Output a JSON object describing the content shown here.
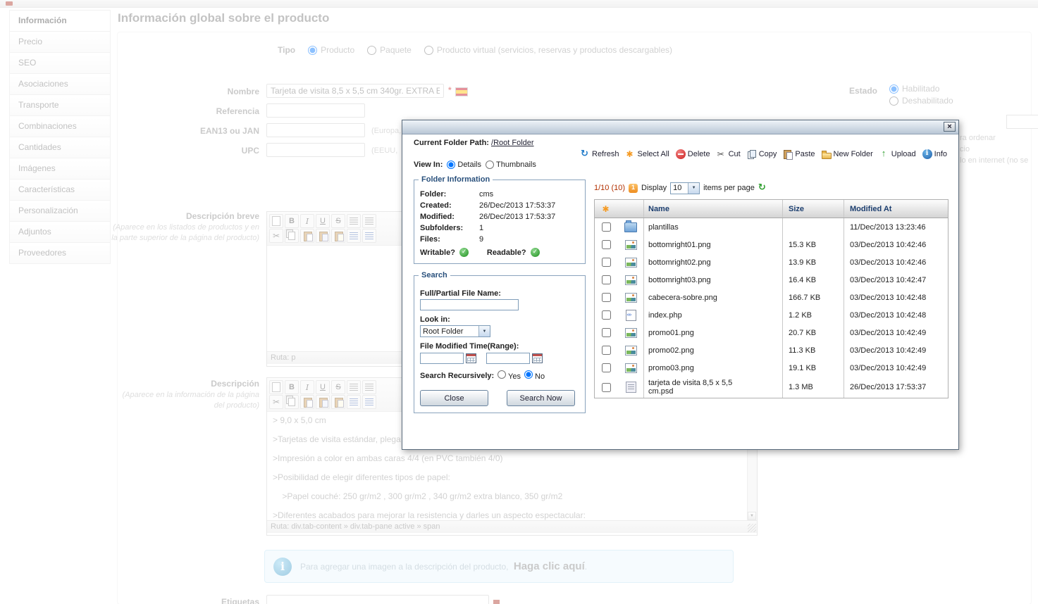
{
  "page": {
    "title": "Información global sobre el producto"
  },
  "sidebar": {
    "items": [
      {
        "label": "Información",
        "active": true
      },
      {
        "label": "Precio",
        "active": false
      },
      {
        "label": "SEO",
        "active": false
      },
      {
        "label": "Asociaciones",
        "active": false
      },
      {
        "label": "Transporte",
        "active": false
      },
      {
        "label": "Combinaciones",
        "active": false
      },
      {
        "label": "Cantidades",
        "active": false
      },
      {
        "label": "Imágenes",
        "active": false
      },
      {
        "label": "Características",
        "active": false
      },
      {
        "label": "Personalización",
        "active": false
      },
      {
        "label": "Adjuntos",
        "active": false
      },
      {
        "label": "Proveedores",
        "active": false
      }
    ]
  },
  "form": {
    "tipo": {
      "label": "Tipo",
      "options": [
        {
          "label": "Producto",
          "checked": true
        },
        {
          "label": "Paquete",
          "checked": false
        },
        {
          "label": "Producto virtual (servicios, reservas y productos descargables)",
          "checked": false
        }
      ]
    },
    "nombre": {
      "label": "Nombre",
      "value": "Tarjeta de visita 8,5 x 5,5 cm 340gr. EXTRA E",
      "required_mark": "*"
    },
    "referencia": {
      "label": "Referencia",
      "value": ""
    },
    "ean13": {
      "label": "EAN13 ou JAN",
      "value": "",
      "hint": "(Europa,"
    },
    "upc": {
      "label": "UPC",
      "value": "",
      "hint": "(EEUU,"
    },
    "estado": {
      "label": "Estado",
      "options": [
        {
          "label": "Habilitado",
          "checked": true
        },
        {
          "label": "Deshabilitado",
          "checked": false
        }
      ]
    },
    "right_fragments": [
      "ra ordenar",
      "cio",
      "lo en internet (no se"
    ],
    "descripcion_breve": {
      "label": "Descripción breve",
      "hint": "(Aparece en los listados de productos y en la parte superior de la página del producto)",
      "ruta": "Ruta: p"
    },
    "descripcion": {
      "label": "Descripción",
      "hint": "(Aparece en la información de la página del producto)",
      "content_lines": [
        "> 9,0 x 5,0 cm",
        ">Tarjetas de visita estándar, plega",
        ">Impresión a color en ambas caras 4/4 (en PVC también 4/0)",
        ">Posibilidad de elegir diferentes tipos de papel:",
        "    >Papel couché: 250 gr/m2 , 300 gr/m2 , 340 gr/m2 extra blanco, 350 gr/m2",
        ">Diferentes acabados para mejorar la resistencia y darles un aspecto espectacular:"
      ],
      "ruta": "Ruta: div.tab-content » div.tab-pane active » span"
    },
    "info_note": {
      "text": "Para agregar una imagen a la descripción del producto,",
      "link": "Haga clic aquí",
      "suffix": "."
    },
    "etiquetas_label": "Etiquetas"
  },
  "editors": {
    "toolbar_row1": [
      "new-page",
      "bold",
      "italic",
      "underline",
      "strikethrough",
      "align-left",
      "align-justify"
    ],
    "toolbar_row2": [
      "cut",
      "copy",
      "paste",
      "paste-word",
      "paste-text",
      "list-ordered",
      "list-unordered"
    ]
  },
  "file_manager": {
    "path_label": "Current Folder Path:",
    "path_value": "/Root Folder",
    "toolbar": [
      {
        "label": "Refresh",
        "icon": "refresh"
      },
      {
        "label": "Select All",
        "icon": "select-all"
      },
      {
        "label": "Delete",
        "icon": "delete"
      },
      {
        "label": "Cut",
        "icon": "cut"
      },
      {
        "label": "Copy",
        "icon": "copy"
      },
      {
        "label": "Paste",
        "icon": "paste"
      },
      {
        "label": "New Folder",
        "icon": "new-folder"
      },
      {
        "label": "Upload",
        "icon": "upload"
      },
      {
        "label": "Info",
        "icon": "info"
      }
    ],
    "view_in": {
      "label": "View In:",
      "options": [
        {
          "label": "Details",
          "checked": true
        },
        {
          "label": "Thumbnails",
          "checked": false
        }
      ]
    },
    "folder_info": {
      "title": "Folder Information",
      "rows": [
        {
          "label": "Folder:",
          "value": "cms"
        },
        {
          "label": "Created:",
          "value": "26/Dec/2013 17:53:37"
        },
        {
          "label": "Modified:",
          "value": "26/Dec/2013 17:53:37"
        },
        {
          "label": "Subfolders:",
          "value": "1"
        },
        {
          "label": "Files:",
          "value": "9"
        }
      ],
      "writable_label": "Writable?",
      "readable_label": "Readable?"
    },
    "search": {
      "title": "Search",
      "file_name_label": "Full/Partial File Name:",
      "look_in_label": "Look in:",
      "look_in_value": "Root Folder",
      "modified_label": "File Modified Time(Range):",
      "recursive_label": "Search Recursively:",
      "recursive_options": [
        {
          "label": "Yes",
          "checked": false
        },
        {
          "label": "No",
          "checked": true
        }
      ],
      "close_button": "Close",
      "search_button": "Search Now"
    },
    "pagination": {
      "position": "1/10 (10)",
      "display_label": "Display",
      "per_page": "10",
      "items_label": "items per page"
    },
    "table": {
      "columns": [
        "Name",
        "Size",
        "Modified At"
      ],
      "rows": [
        {
          "name": "plantillas",
          "size": "",
          "modified": "11/Dec/2013 13:23:46",
          "type": "folder"
        },
        {
          "name": "bottomright01.png",
          "size": "15.3 KB",
          "modified": "03/Dec/2013 10:42:46",
          "type": "image"
        },
        {
          "name": "bottomright02.png",
          "size": "13.9 KB",
          "modified": "03/Dec/2013 10:42:46",
          "type": "image"
        },
        {
          "name": "bottomright03.png",
          "size": "16.4 KB",
          "modified": "03/Dec/2013 10:42:47",
          "type": "image"
        },
        {
          "name": "cabecera-sobre.png",
          "size": "166.7 KB",
          "modified": "03/Dec/2013 10:42:48",
          "type": "image"
        },
        {
          "name": "index.php",
          "size": "1.2 KB",
          "modified": "03/Dec/2013 10:42:48",
          "type": "php"
        },
        {
          "name": "promo01.png",
          "size": "20.7 KB",
          "modified": "03/Dec/2013 10:42:49",
          "type": "image"
        },
        {
          "name": "promo02.png",
          "size": "11.3 KB",
          "modified": "03/Dec/2013 10:42:49",
          "type": "image"
        },
        {
          "name": "promo03.png",
          "size": "19.1 KB",
          "modified": "03/Dec/2013 10:42:49",
          "type": "image"
        },
        {
          "name": "tarjeta de visita 8,5 x 5,5 cm.psd",
          "size": "1.3 MB",
          "modified": "26/Dec/2013 17:53:37",
          "type": "psd"
        }
      ]
    }
  }
}
